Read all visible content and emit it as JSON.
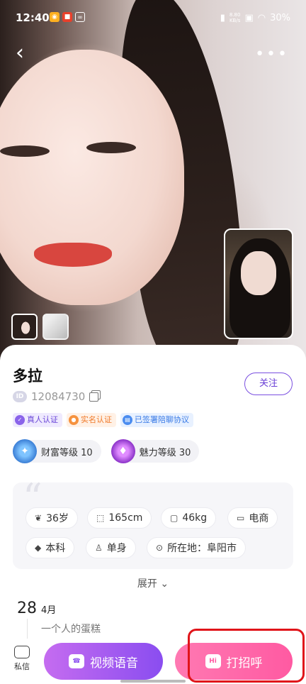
{
  "status_bar": {
    "time": "12:40",
    "net_speed_top": "8.80",
    "net_speed_unit": "KB/s",
    "battery": "30%"
  },
  "profile": {
    "name": "多拉",
    "id": "12084730",
    "follow_label": "关注"
  },
  "badges": [
    {
      "label": "真人认证",
      "color": "#6a46d8"
    },
    {
      "label": "实名认证",
      "color": "#f07a2a"
    },
    {
      "label": "已签署陪聊协议",
      "color": "#3a7be6"
    }
  ],
  "levels": [
    {
      "label": "财富等级 10"
    },
    {
      "label": "魅力等级 30"
    }
  ],
  "tags": [
    {
      "label": "36岁",
      "icon": "sprout-icon"
    },
    {
      "label": "165cm",
      "icon": "ruler-icon"
    },
    {
      "label": "46kg",
      "icon": "scale-icon"
    },
    {
      "label": "电商",
      "icon": "chart-icon"
    },
    {
      "label": "本科",
      "icon": "graduation-cap-icon"
    },
    {
      "label": "单身",
      "icon": "person-icon"
    },
    {
      "label": "所在地：阜阳市",
      "icon": "location-pin-icon"
    }
  ],
  "expand_label": "展开",
  "moment": {
    "day": "28",
    "month": "4月",
    "text": "一个人的蛋糕"
  },
  "bottom": {
    "message_label": "私信",
    "video_label": "视频语音",
    "greet_label": "打招呼",
    "greet_icon_text": "Hi"
  }
}
